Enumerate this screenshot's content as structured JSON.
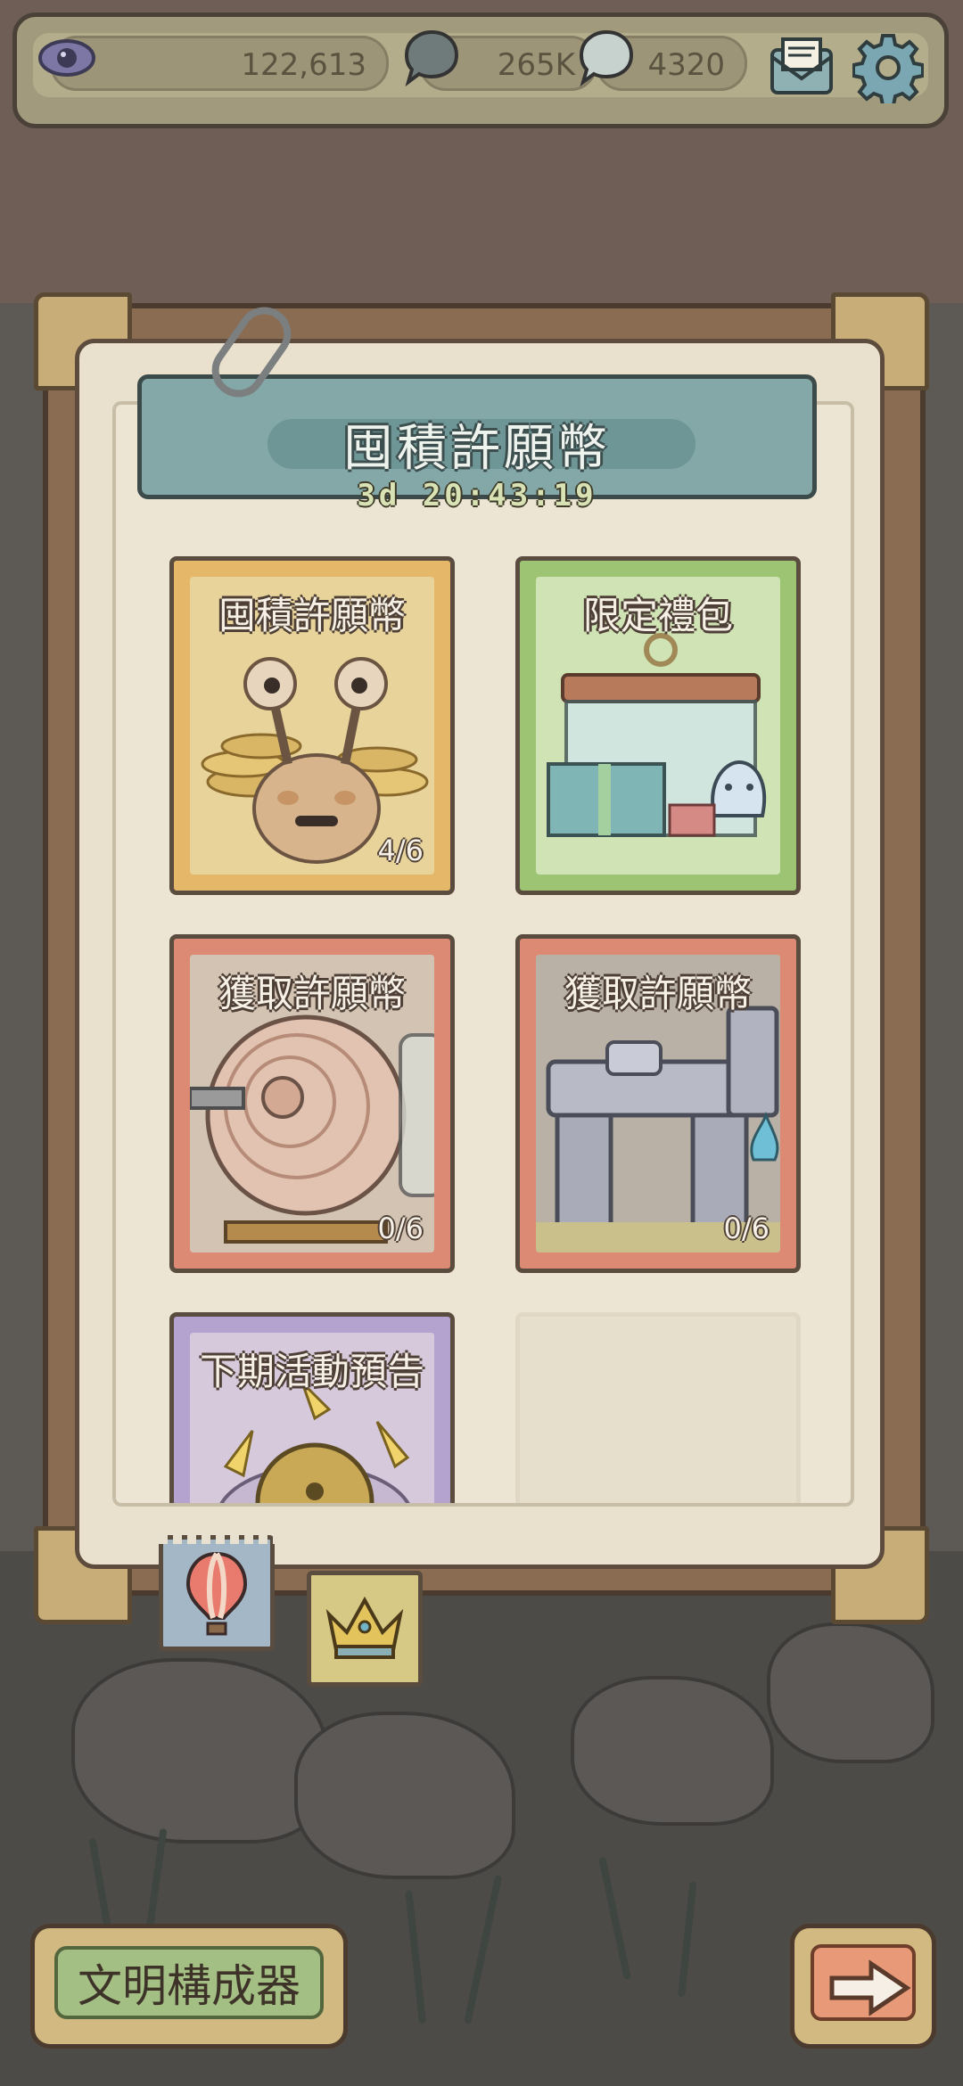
{
  "resources": {
    "eye_value": "122,613",
    "bubble_dark_value": "265K",
    "bubble_light_value": "4320"
  },
  "event": {
    "title": "囤積許願幣",
    "timer": "3d 20:43:19"
  },
  "cards": [
    {
      "title": "囤積許願幣",
      "count": "4/6",
      "theme": "yellow"
    },
    {
      "title": "限定禮包",
      "count": "",
      "theme": "green"
    },
    {
      "title": "獲取許願幣",
      "count": "0/6",
      "theme": "red"
    },
    {
      "title": "獲取許願幣",
      "count": "0/6",
      "theme": "red"
    },
    {
      "title": "下期活動預告",
      "count": "",
      "theme": "purple"
    }
  ],
  "tabs": [
    {
      "icon": "hot-air-balloon-icon",
      "selected": true
    },
    {
      "icon": "crown-icon",
      "selected": false
    }
  ],
  "buttons": {
    "civ_label": "文明構成器",
    "next_icon": "arrow-right-icon"
  },
  "colors": {
    "banner": "#84a8a8",
    "card_yellow": "#e5b769",
    "card_green": "#9cc472",
    "card_red": "#dd8a74",
    "card_purple": "#b5a3cf"
  }
}
